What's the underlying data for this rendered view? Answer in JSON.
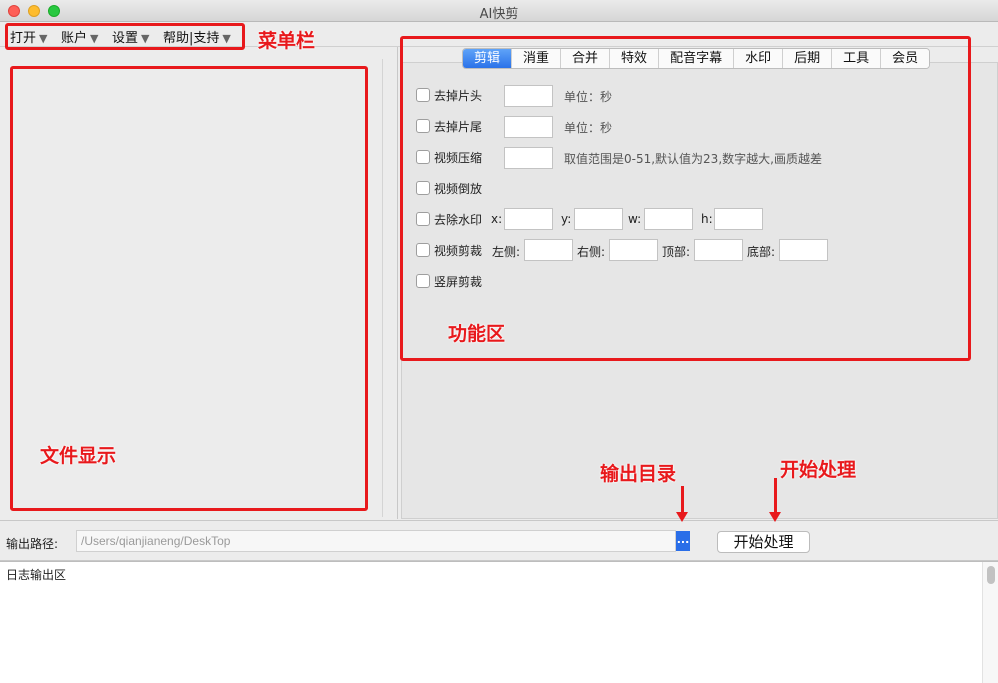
{
  "window": {
    "title": "AI快剪"
  },
  "menu": {
    "items": [
      {
        "label": "打开"
      },
      {
        "label": "账户"
      },
      {
        "label": "设置"
      },
      {
        "label": "帮助|支持"
      }
    ],
    "arrow": "▼"
  },
  "tabs": [
    "剪辑",
    "消重",
    "合并",
    "特效",
    "配音字幕",
    "水印",
    "后期",
    "工具",
    "会员"
  ],
  "active_tab": "剪辑",
  "options": {
    "trim_head": {
      "label": "去掉片头",
      "unit": "单位：秒"
    },
    "trim_tail": {
      "label": "去掉片尾",
      "unit": "单位：秒"
    },
    "compress": {
      "label": "视频压缩",
      "hint": "取值范围是0-51,默认值为23,数字越大,画质越差"
    },
    "reverse": {
      "label": "视频倒放"
    },
    "remove_watermark": {
      "label": "去除水印",
      "x": "x:",
      "y": "y:",
      "w": "w:",
      "h": "h:"
    },
    "crop": {
      "label": "视频剪裁",
      "left": "左侧:",
      "right": "右侧:",
      "top": "顶部:",
      "bottom": "底部:"
    },
    "vertical_crop": {
      "label": "竖屏剪裁"
    }
  },
  "output": {
    "label": "输出路径:",
    "placeholder": "/Users/qianjianeng/DeskTop",
    "browse": "...",
    "start": "开始处理"
  },
  "log": {
    "text": "日志输出区"
  },
  "annotations": {
    "menu_bar": "菜单栏",
    "function_area": "功能区",
    "file_display": "文件显示",
    "output_dir": "输出目录",
    "start_process": "开始处理"
  },
  "colors": {
    "annotation_red": "#e8191c",
    "tab_active": "#2a72e9"
  }
}
